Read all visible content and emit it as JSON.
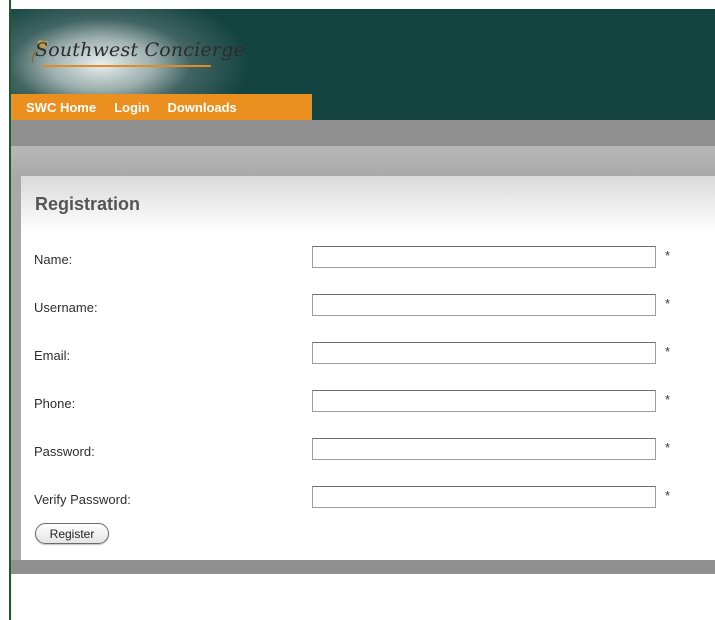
{
  "header": {
    "logo_text": "Southwest Concierge",
    "logo_icon": "rose-icon"
  },
  "nav": {
    "items": [
      {
        "label": "SWC Home"
      },
      {
        "label": "Login"
      },
      {
        "label": "Downloads"
      }
    ]
  },
  "form": {
    "title": "Registration",
    "fields": [
      {
        "label": "Name:",
        "value": "",
        "required_marker": "*"
      },
      {
        "label": "Username:",
        "value": "",
        "required_marker": "*"
      },
      {
        "label": "Email:",
        "value": "",
        "required_marker": "*"
      },
      {
        "label": "Phone:",
        "value": "",
        "required_marker": "*"
      },
      {
        "label": "Password:",
        "value": "",
        "required_marker": "*"
      },
      {
        "label": "Verify Password:",
        "value": "",
        "required_marker": "*"
      }
    ],
    "submit_label": "Register"
  },
  "colors": {
    "header_bg": "#13433f",
    "nav_bg": "#eb8f1e",
    "bar_gray": "#8f8f8f",
    "accent": "#e08c2a"
  }
}
